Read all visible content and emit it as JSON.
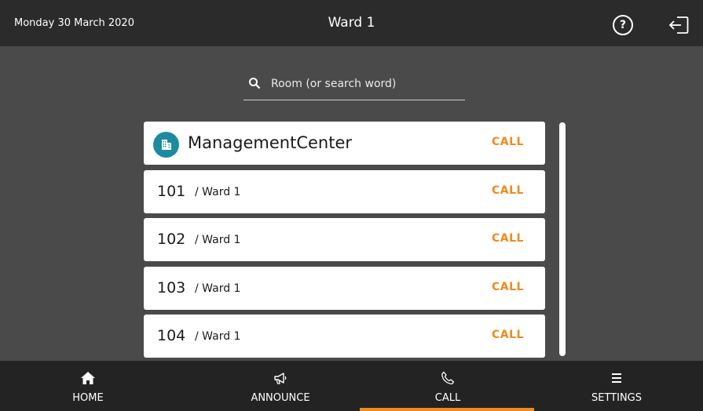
{
  "header": {
    "date": "Monday 30 March 2020",
    "title": "Ward 1",
    "help_glyph": "?",
    "help_icon": "question-circle-icon",
    "logout_icon": "logout-icon"
  },
  "search": {
    "placeholder": "Room (or search word)",
    "icon": "search-icon"
  },
  "rooms": [
    {
      "name": "ManagementCenter",
      "ward": "",
      "action": "CALL",
      "icon": "building-icon"
    },
    {
      "name": "101",
      "ward": "/ Ward 1",
      "action": "CALL"
    },
    {
      "name": "102",
      "ward": "/ Ward 1",
      "action": "CALL"
    },
    {
      "name": "103",
      "ward": "/ Ward 1",
      "action": "CALL"
    },
    {
      "name": "104",
      "ward": "/ Ward 1",
      "action": "CALL"
    }
  ],
  "nav": {
    "items": [
      {
        "label": "HOME",
        "icon": "home-icon",
        "active": false
      },
      {
        "label": "ANNOUNCE",
        "icon": "megaphone-icon",
        "active": false
      },
      {
        "label": "CALL",
        "icon": "phone-icon",
        "active": true
      },
      {
        "label": "SETTINGS",
        "icon": "menu-icon",
        "active": false
      }
    ]
  },
  "colors": {
    "accent": "#f08a1e",
    "header_bg": "#2b2b2b",
    "body_bg": "#4a4a4a",
    "footer_bg": "#232323",
    "avatar": "#1e8aa0"
  }
}
